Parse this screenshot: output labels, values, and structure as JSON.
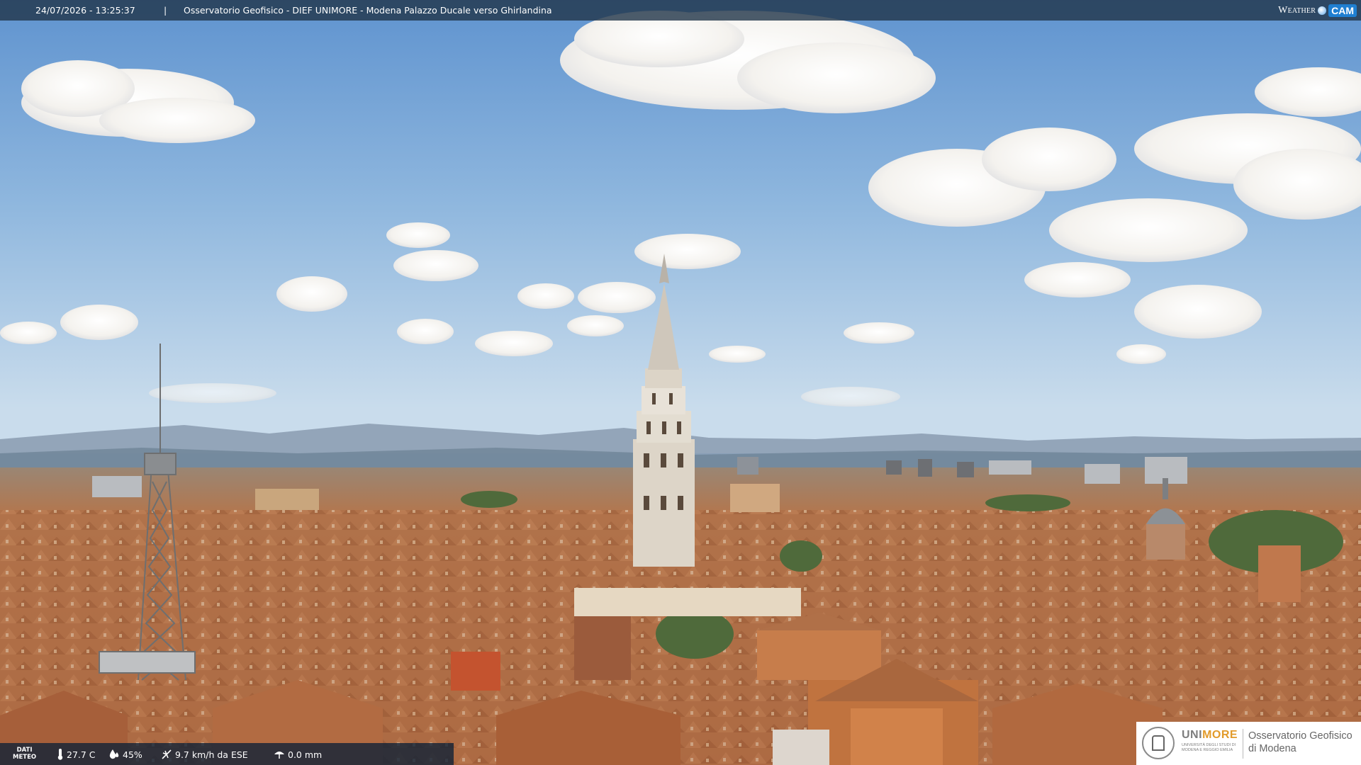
{
  "overlay": {
    "timestamp": "24/07/2026 - 13:25:37",
    "separator": "|",
    "camera_title": "Osservatorio Geofisico - DIEF UNIMORE - Modena Palazzo Ducale verso Ghirlandina",
    "brand_weather": "Weather",
    "brand_cam": "CAM"
  },
  "weather": {
    "label_line1": "DATI",
    "label_line2": "METEO",
    "temperature": "27.7 C",
    "humidity": "45%",
    "wind": "9.7 km/h da ESE",
    "rain": "0.0 mm"
  },
  "logo": {
    "uni": "UNI",
    "more": "MORE",
    "sub_line1": "UNIVERSITÀ DEGLI STUDI DI",
    "sub_line2": "MODENA E REGGIO EMILIA",
    "org_line1": "Osservatorio Geofisico",
    "org_line2": "di Modena"
  },
  "icons": [
    "thermometer-icon",
    "humidity-icon",
    "wind-icon",
    "rain-icon",
    "university-seal-icon"
  ],
  "colors": {
    "sky_top": "#5f93cf",
    "sky_horizon": "#c9dcec",
    "roof": "#b0714a",
    "tower": "#e6e0d6",
    "overlay_bar": "#213448",
    "logo_accent": "#e29b2b"
  }
}
